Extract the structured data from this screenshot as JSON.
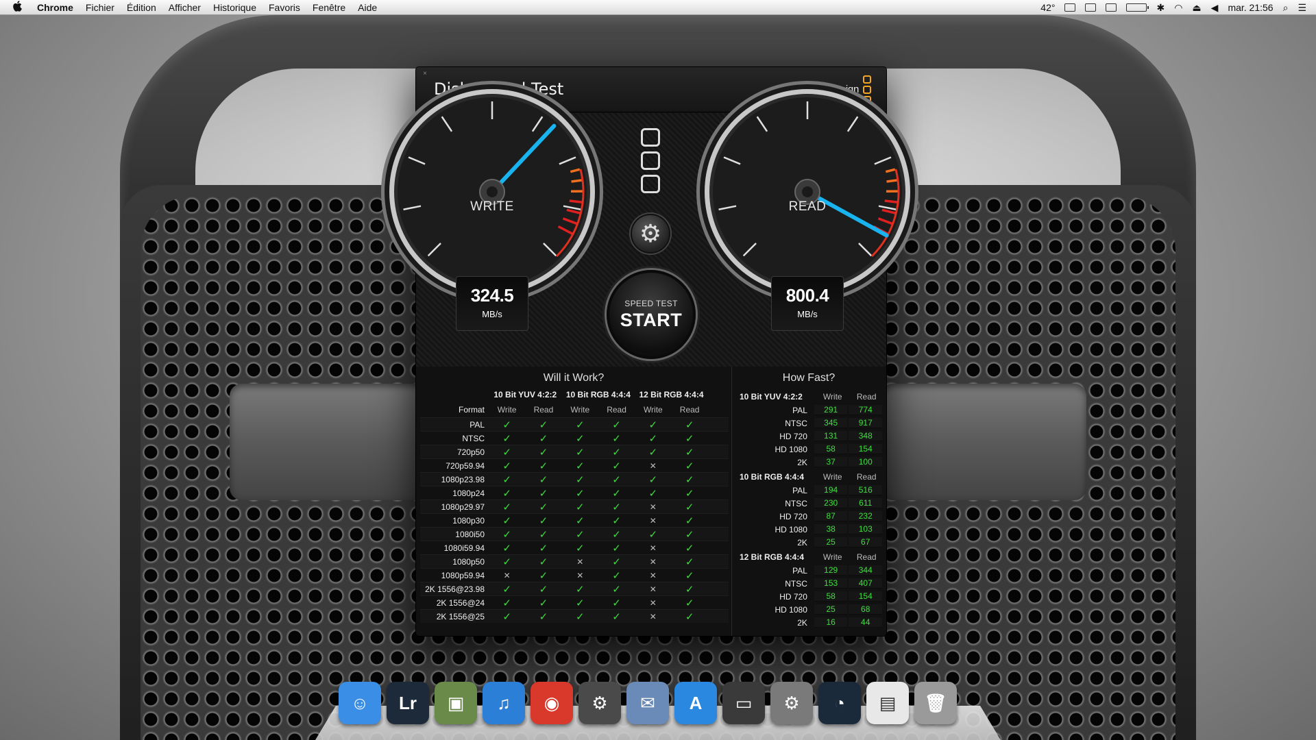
{
  "menubar": {
    "app": "Chrome",
    "items": [
      "Fichier",
      "Édition",
      "Afficher",
      "Historique",
      "Favoris",
      "Fenêtre",
      "Aide"
    ],
    "temperature": "42°",
    "clock": "mar. 21:56"
  },
  "window": {
    "title": "Disk Speed Test",
    "brand": "Blackmagicdesign",
    "close": "×"
  },
  "gauges": {
    "write": {
      "label": "WRITE",
      "value": "324.5",
      "unit": "MB/s",
      "needle_fraction": 0.66
    },
    "read": {
      "label": "READ",
      "value": "800.4",
      "unit": "MB/s",
      "needle_fraction": 0.94
    },
    "accent_color": "#19b4f0"
  },
  "start_button": {
    "small": "SPEED TEST",
    "big": "START"
  },
  "will_it_work": {
    "title": "Will it Work?",
    "format_header": "Format",
    "groups": [
      "10 Bit YUV 4:2:2",
      "10 Bit RGB 4:4:4",
      "12 Bit RGB 4:4:4"
    ],
    "sub": [
      "Write",
      "Read",
      "Write",
      "Read",
      "Write",
      "Read"
    ],
    "rows": [
      {
        "format": "PAL",
        "cells": [
          1,
          1,
          1,
          1,
          1,
          1
        ]
      },
      {
        "format": "NTSC",
        "cells": [
          1,
          1,
          1,
          1,
          1,
          1
        ]
      },
      {
        "format": "720p50",
        "cells": [
          1,
          1,
          1,
          1,
          1,
          1
        ]
      },
      {
        "format": "720p59.94",
        "cells": [
          1,
          1,
          1,
          1,
          0,
          1
        ]
      },
      {
        "format": "1080p23.98",
        "cells": [
          1,
          1,
          1,
          1,
          1,
          1
        ]
      },
      {
        "format": "1080p24",
        "cells": [
          1,
          1,
          1,
          1,
          1,
          1
        ]
      },
      {
        "format": "1080p29.97",
        "cells": [
          1,
          1,
          1,
          1,
          0,
          1
        ]
      },
      {
        "format": "1080p30",
        "cells": [
          1,
          1,
          1,
          1,
          0,
          1
        ]
      },
      {
        "format": "1080i50",
        "cells": [
          1,
          1,
          1,
          1,
          1,
          1
        ]
      },
      {
        "format": "1080i59.94",
        "cells": [
          1,
          1,
          1,
          1,
          0,
          1
        ]
      },
      {
        "format": "1080p50",
        "cells": [
          1,
          1,
          0,
          1,
          0,
          1
        ]
      },
      {
        "format": "1080p59.94",
        "cells": [
          0,
          1,
          0,
          1,
          0,
          1
        ]
      },
      {
        "format": "2K 1556@23.98",
        "cells": [
          1,
          1,
          1,
          1,
          0,
          1
        ]
      },
      {
        "format": "2K 1556@24",
        "cells": [
          1,
          1,
          1,
          1,
          0,
          1
        ]
      },
      {
        "format": "2K 1556@25",
        "cells": [
          1,
          1,
          1,
          1,
          0,
          1
        ]
      }
    ]
  },
  "how_fast": {
    "title": "How Fast?",
    "col_write": "Write",
    "col_read": "Read",
    "groups": [
      {
        "name": "10 Bit YUV 4:2:2",
        "rows": [
          {
            "format": "PAL",
            "write": "291",
            "read": "774"
          },
          {
            "format": "NTSC",
            "write": "345",
            "read": "917"
          },
          {
            "format": "HD 720",
            "write": "131",
            "read": "348"
          },
          {
            "format": "HD 1080",
            "write": "58",
            "read": "154"
          },
          {
            "format": "2K",
            "write": "37",
            "read": "100"
          }
        ]
      },
      {
        "name": "10 Bit RGB 4:4:4",
        "rows": [
          {
            "format": "PAL",
            "write": "194",
            "read": "516"
          },
          {
            "format": "NTSC",
            "write": "230",
            "read": "611"
          },
          {
            "format": "HD 720",
            "write": "87",
            "read": "232"
          },
          {
            "format": "HD 1080",
            "write": "38",
            "read": "103"
          },
          {
            "format": "2K",
            "write": "25",
            "read": "67"
          }
        ]
      },
      {
        "name": "12 Bit RGB 4:4:4",
        "rows": [
          {
            "format": "PAL",
            "write": "129",
            "read": "344"
          },
          {
            "format": "NTSC",
            "write": "153",
            "read": "407"
          },
          {
            "format": "HD 720",
            "write": "58",
            "read": "154"
          },
          {
            "format": "HD 1080",
            "write": "25",
            "read": "68"
          },
          {
            "format": "2K",
            "write": "16",
            "read": "44"
          }
        ]
      }
    ]
  },
  "dock": {
    "items": [
      {
        "name": "finder",
        "glyph": "☺",
        "color": "#3a8ee6"
      },
      {
        "name": "lightroom",
        "glyph": "Lr",
        "color": "#1c2a3a"
      },
      {
        "name": "preview",
        "glyph": "▣",
        "color": "#6a8a4a"
      },
      {
        "name": "itunes",
        "glyph": "♫",
        "color": "#2b7fd6"
      },
      {
        "name": "chrome",
        "glyph": "◉",
        "color": "#d8392b"
      },
      {
        "name": "steam",
        "glyph": "⚙",
        "color": "#4a4a4a"
      },
      {
        "name": "mail",
        "glyph": "✉",
        "color": "#6a8ab8"
      },
      {
        "name": "app-store",
        "glyph": "A",
        "color": "#2a88e0"
      },
      {
        "name": "ps3-media",
        "glyph": "▭",
        "color": "#3a3a3a"
      },
      {
        "name": "system-preferences",
        "glyph": "⚙",
        "color": "#7a7a7a"
      },
      {
        "name": "disk-speed-test",
        "glyph": "◔",
        "color": "#1a2a3a"
      },
      {
        "name": "documents",
        "glyph": "▤",
        "color": "#e8e8e8"
      },
      {
        "name": "trash",
        "glyph": "🗑",
        "color": "#9a9a9a"
      }
    ]
  }
}
